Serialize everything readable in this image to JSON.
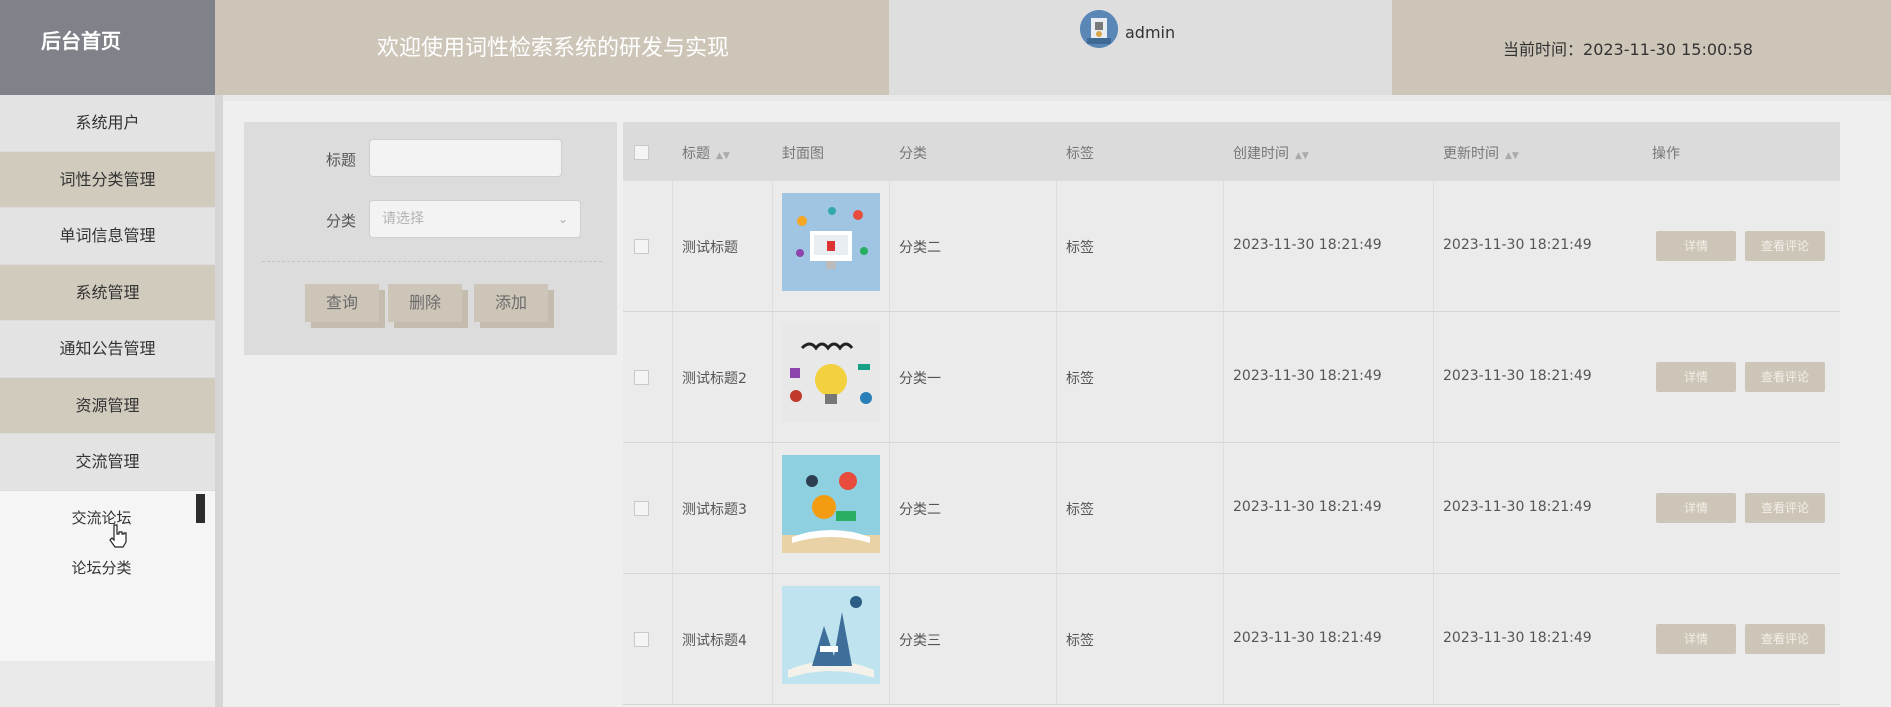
{
  "header": {
    "brand": "后台首页",
    "system_title": "欢迎使用词性检索系统的研发与实现",
    "username": "admin",
    "time_label": "当前时间：",
    "time_value": "2023-11-30 15:00:58"
  },
  "sidebar": {
    "items": [
      {
        "label": "系统用户"
      },
      {
        "label": "词性分类管理"
      },
      {
        "label": "单词信息管理"
      },
      {
        "label": "系统管理"
      },
      {
        "label": "通知公告管理"
      },
      {
        "label": "资源管理"
      },
      {
        "label": "交流管理"
      }
    ],
    "sub_items": [
      {
        "label": "交流论坛"
      },
      {
        "label": "论坛分类"
      }
    ]
  },
  "search": {
    "title_label": "标题",
    "title_value": "",
    "category_label": "分类",
    "category_placeholder": "请选择",
    "query_button": "查询",
    "delete_button": "删除",
    "add_button": "添加"
  },
  "table": {
    "headers": [
      "标题",
      "封面图",
      "分类",
      "标签",
      "创建时间",
      "更新时间",
      "操作"
    ],
    "rows": [
      {
        "title": "测试标题",
        "category": "分类二",
        "tag": "标签",
        "created": "2023-11-30 18:21:49",
        "updated": "2023-11-30 18:21:49",
        "image": "computer-illustration"
      },
      {
        "title": "测试标题2",
        "category": "分类一",
        "tag": "标签",
        "created": "2023-11-30 18:21:49",
        "updated": "2023-11-30 18:21:49",
        "image": "learn-lightbulb"
      },
      {
        "title": "测试标题3",
        "category": "分类二",
        "tag": "标签",
        "created": "2023-11-30 18:21:49",
        "updated": "2023-11-30 18:21:49",
        "image": "open-book-travel"
      },
      {
        "title": "测试标题4",
        "category": "分类三",
        "tag": "标签",
        "created": "2023-11-30 18:21:49",
        "updated": "2023-11-30 18:21:49",
        "image": "open-book-words"
      }
    ],
    "action_detail": "详情",
    "action_comments": "查看评论"
  },
  "colors": {
    "accent": "#cdc6b8",
    "brand_bg": "#7f8289"
  }
}
